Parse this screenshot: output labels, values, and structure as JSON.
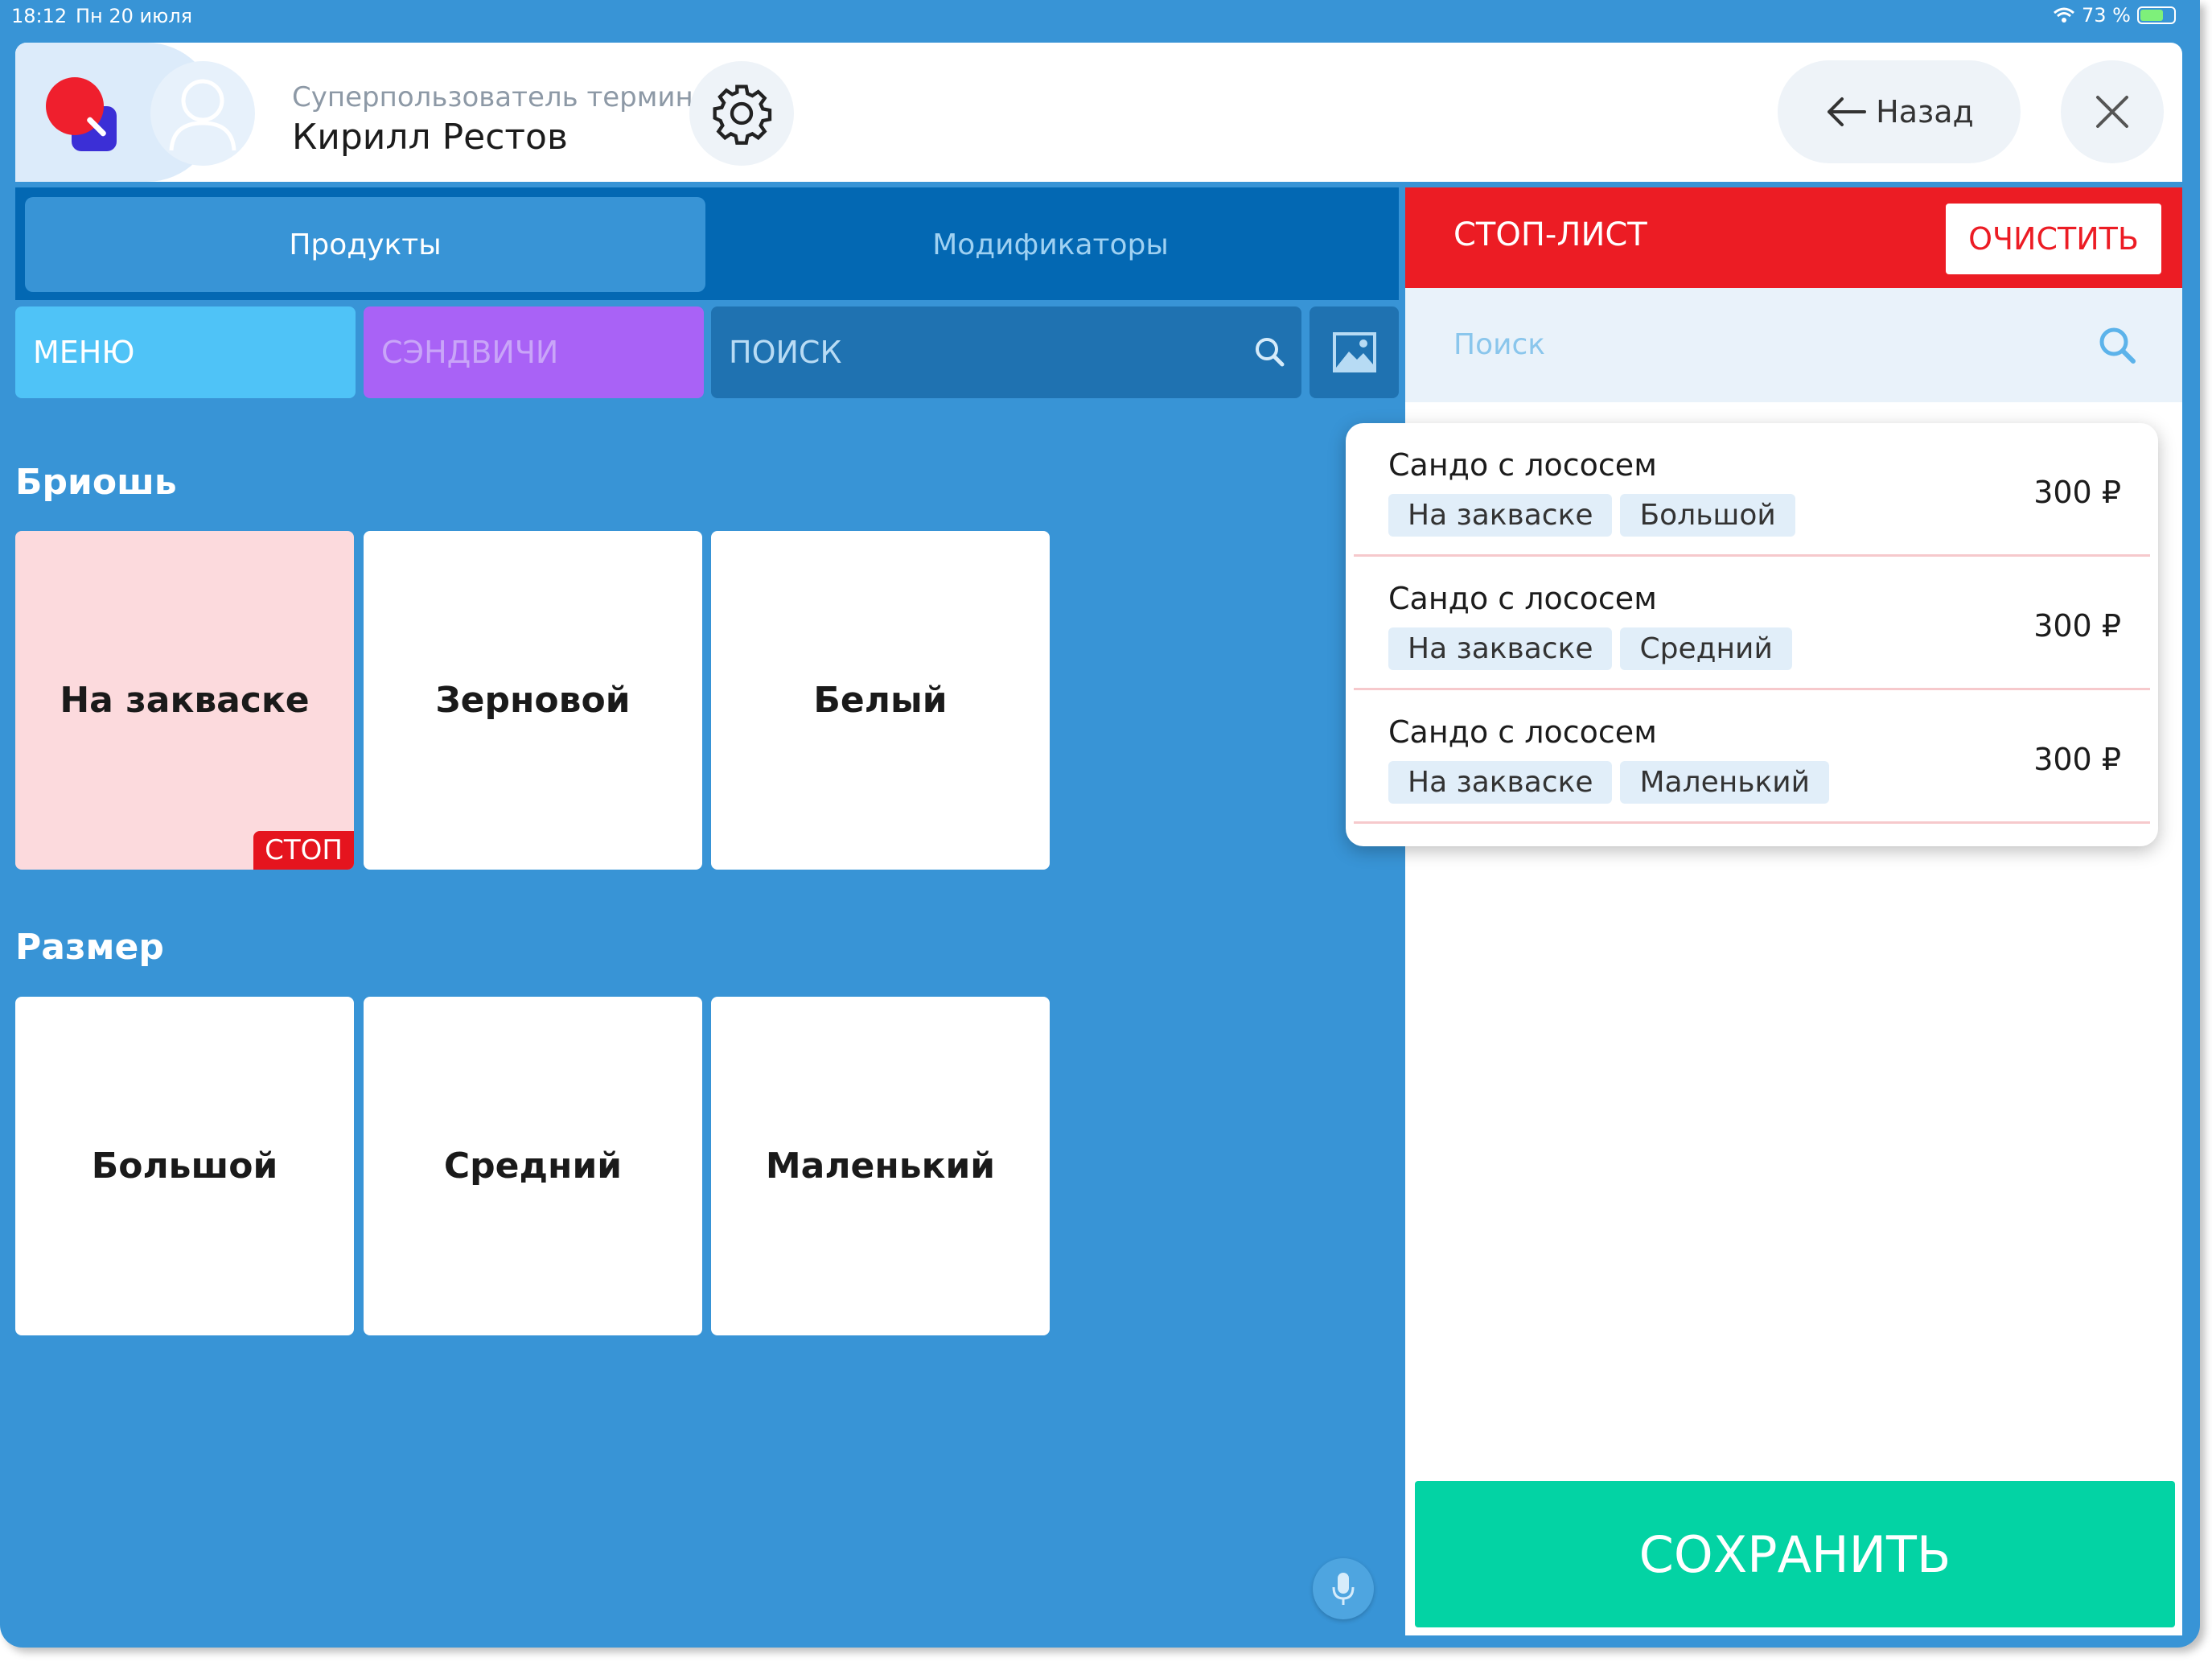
{
  "status_bar": {
    "time": "18:12",
    "date": "Пн 20 июля",
    "battery_percent": "73 %"
  },
  "header": {
    "user_role": "Суперпользователь термин...",
    "user_name": "Кирилл Рестов",
    "back_label": "Назад"
  },
  "tabs": [
    {
      "label": "Продукты",
      "active": true
    },
    {
      "label": "Модификаторы",
      "active": false
    }
  ],
  "filters": {
    "menu_label": "МЕНЮ",
    "category_label": "СЭНДВИЧИ",
    "search_placeholder": "ПОИСК"
  },
  "sections": [
    {
      "title": "Бриошь",
      "items": [
        {
          "label": "На закваске",
          "stopped": true
        },
        {
          "label": "Зерновой",
          "stopped": false
        },
        {
          "label": "Белый",
          "stopped": false
        }
      ]
    },
    {
      "title": "Размер",
      "items": [
        {
          "label": "Большой",
          "stopped": false
        },
        {
          "label": "Средний",
          "stopped": false
        },
        {
          "label": "Маленький",
          "stopped": false
        }
      ]
    }
  ],
  "stop_badge": "СТОП",
  "stop_list": {
    "title": "СТОП-ЛИСТ",
    "clear_label": "ОЧИСТИТЬ",
    "search_placeholder": "Поиск",
    "items": [
      {
        "name": "Сандо с лососем",
        "modifiers": [
          "На закваске",
          "Большой"
        ],
        "price": "300 ₽"
      },
      {
        "name": "Сандо с лососем",
        "modifiers": [
          "На закваске",
          "Средний"
        ],
        "price": "300 ₽"
      },
      {
        "name": "Сандо с лососем",
        "modifiers": [
          "На закваске",
          "Маленький"
        ],
        "price": "300 ₽"
      }
    ],
    "save_label": "СОХРАНИТЬ"
  },
  "colors": {
    "background": "#3894d6",
    "tab_bar": "#0368b3",
    "stop_red": "#ec1c24",
    "save_green": "#03d3a4",
    "menu_chip": "#4fc3f7",
    "category_chip": "#a962f6"
  }
}
